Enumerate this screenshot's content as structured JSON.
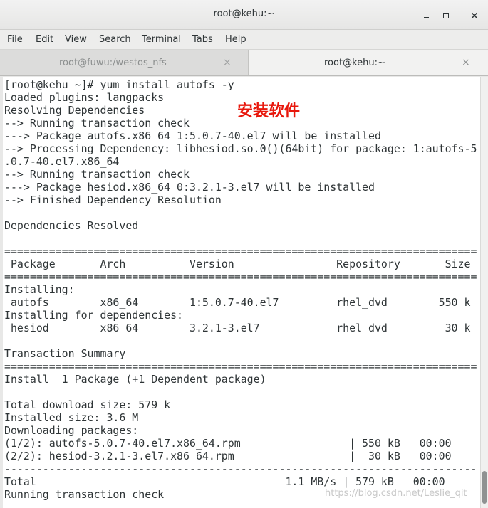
{
  "window": {
    "title": "root@kehu:~",
    "minimize_icon": "minimize-icon",
    "maximize_icon": "maximize-icon",
    "close_glyph": "×"
  },
  "menu": {
    "items": [
      "File",
      "Edit",
      "View",
      "Search",
      "Terminal",
      "Tabs",
      "Help"
    ]
  },
  "tabs": [
    {
      "label": "root@fuwu:/westos_nfs",
      "close": "×",
      "active": false
    },
    {
      "label": "root@kehu:~",
      "close": "×",
      "active": true
    }
  ],
  "terminal": {
    "lines": [
      "[root@kehu ~]# yum install autofs -y",
      "Loaded plugins: langpacks",
      "Resolving Dependencies",
      "--> Running transaction check",
      "---> Package autofs.x86_64 1:5.0.7-40.el7 will be installed",
      "--> Processing Dependency: libhesiod.so.0()(64bit) for package: 1:autofs-5",
      ".0.7-40.el7.x86_64",
      "--> Running transaction check",
      "---> Package hesiod.x86_64 0:3.2.1-3.el7 will be installed",
      "--> Finished Dependency Resolution",
      "",
      "Dependencies Resolved",
      "",
      "==========================================================================",
      " Package       Arch          Version                Repository       Size",
      "==========================================================================",
      "Installing:",
      " autofs        x86_64        1:5.0.7-40.el7         rhel_dvd        550 k",
      "Installing for dependencies:",
      " hesiod        x86_64        3.2.1-3.el7            rhel_dvd         30 k",
      "",
      "Transaction Summary",
      "==========================================================================",
      "Install  1 Package (+1 Dependent package)",
      "",
      "Total download size: 579 k",
      "Installed size: 3.6 M",
      "Downloading packages:",
      "(1/2): autofs-5.0.7-40.el7.x86_64.rpm                 | 550 kB   00:00",
      "(2/2): hesiod-3.2.1-3.el7.x86_64.rpm                  |  30 kB   00:00",
      "--------------------------------------------------------------------------",
      "Total                                       1.1 MB/s | 579 kB   00:00",
      "Running transaction check"
    ]
  },
  "annotation": {
    "text": "安装软件",
    "color": "#e8170c"
  },
  "watermark": "https://blog.csdn.net/Leslie_qit",
  "colors": {
    "terminal_bg": "#ffffff",
    "terminal_fg": "#2e3436",
    "chrome_bg": "#ededec"
  }
}
